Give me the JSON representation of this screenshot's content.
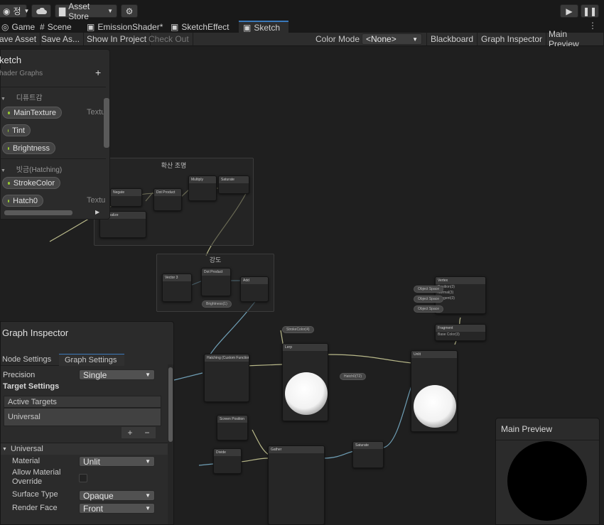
{
  "topbar": {
    "account_label": "정",
    "cloud_icon": "cloud-icon",
    "asset_store_label": "Asset Store",
    "play_icon": "play-icon",
    "pause_icon": "pause-icon"
  },
  "tabs": [
    {
      "label": "Game",
      "icon": "game-icon"
    },
    {
      "label": "Scene",
      "icon": "hash-icon"
    },
    {
      "label": "EmissionShader*",
      "icon": "shadergraph-icon"
    },
    {
      "label": "SketchEffect",
      "icon": "shadergraph-icon"
    },
    {
      "label": "Sketch",
      "icon": "shadergraph-icon"
    }
  ],
  "toolbar": {
    "save_asset": "ave Asset",
    "save_as": "Save As...",
    "show_in_project": "Show In Project",
    "check_out": "Check Out",
    "color_mode_label": "Color Mode",
    "color_mode_value": "<None>",
    "blackboard": "Blackboard",
    "graph_inspector": "Graph Inspector",
    "main_preview": "Main Preview"
  },
  "blackboard": {
    "title": "ketch",
    "subtitle": "hader Graphs",
    "add_icon": "+",
    "category1": "디퓨트감",
    "props1": [
      {
        "name": "MainTexture",
        "type": "Textu"
      },
      {
        "name": "Tint",
        "type": ""
      },
      {
        "name": "Brightness",
        "type": ""
      }
    ],
    "category2": "빗금(Hatching)",
    "props2": [
      {
        "name": "StrokeColor",
        "type": ""
      },
      {
        "name": "Hatch0",
        "type": "Textu"
      }
    ]
  },
  "canvas": {
    "group1_title": "확산 조명",
    "group2_title": "강도",
    "node_labels": {
      "multiply": "Multiply",
      "saturate": "Saturate",
      "negate": "Negate",
      "dot_product": "Dot Product",
      "dot_product2": "Dot Product",
      "normalize": "Normalize",
      "vector3": "Vector 3",
      "add": "Add",
      "hatching": "Hatching (Custom Function)",
      "vertex": "Vertex",
      "fragment": "Fragment",
      "unlit": "Unlit",
      "screen_position": "Screen Position",
      "divide": "Divide",
      "gather": "Gather",
      "lerp": "Lerp"
    },
    "vertex_ports": [
      "Position(3)",
      "Normal(3)",
      "Tangent(3)"
    ],
    "vertex_pills": [
      "Object Space",
      "Object Space",
      "Object Space"
    ],
    "fragment_ports": [
      "Base Color(3)"
    ],
    "pill_labels": [
      "StrokeColor(4)",
      "Brightness(1)",
      "Hatch0(T2)"
    ]
  },
  "inspector": {
    "title": "Graph Inspector",
    "tab_node": "Node Settings",
    "tab_graph": "Graph Settings",
    "precision_label": "Precision",
    "precision_value": "Single",
    "target_settings": "Target Settings",
    "active_targets": "Active Targets",
    "target_item": "Universal",
    "add_icon": "+",
    "remove_icon": "−",
    "section": "Universal",
    "material_label": "Material",
    "material_value": "Unlit",
    "allow_override_label": "Allow Material Override",
    "surface_type_label": "Surface Type",
    "surface_type_value": "Opaque",
    "render_face_label": "Render Face",
    "render_face_value": "Front"
  },
  "preview": {
    "title": "Main Preview"
  },
  "colors": {
    "accent": "#3a79bb",
    "wire_yellow": "#b9b98a",
    "wire_blue": "#6f9fb6",
    "panel_bg": "#2b2b2b"
  }
}
